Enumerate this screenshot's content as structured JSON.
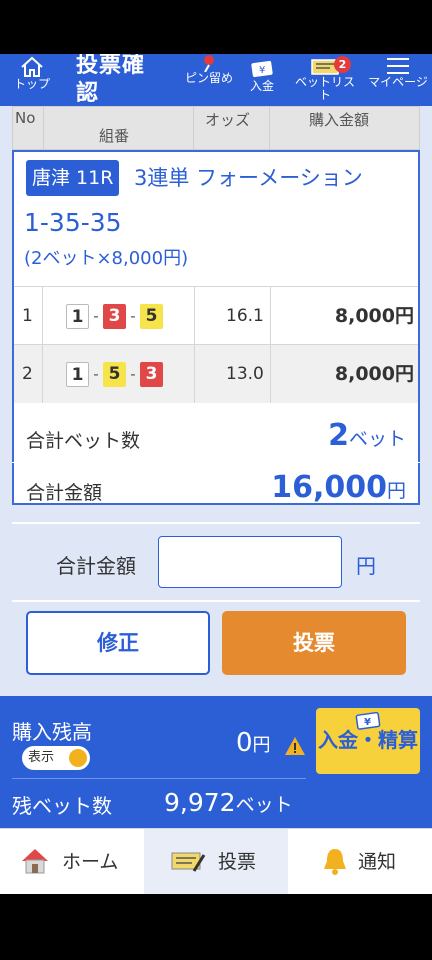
{
  "header": {
    "home_label": "トップ",
    "title": "投票確認",
    "pin_label": "ピン留め",
    "deposit_label": "入金",
    "bet_list_label": "ベットリスト",
    "bet_list_badge": "2",
    "mypage_label": "マイページ"
  },
  "table_header": {
    "no": "No",
    "combination": "組番",
    "odds": "オッズ",
    "amount": "購入金額"
  },
  "bet_card": {
    "venue_race": "唐津 11R",
    "bet_type": "3連単 フォーメーション",
    "combination": "1-35-35",
    "bet_note": "(2ベット×8,000円)",
    "rows": [
      {
        "no": "1",
        "n1": "1",
        "n2": "3",
        "n3": "5",
        "odds": "16.1",
        "amount": "8,000円"
      },
      {
        "no": "2",
        "n1": "1",
        "n2": "5",
        "n3": "3",
        "odds": "13.0",
        "amount": "8,000円"
      }
    ]
  },
  "summary": {
    "bets_label": "合計ベット数",
    "bets_value": "2",
    "bets_unit": "ベット",
    "total_label": "合計金額",
    "total_value": "16,000",
    "total_unit": "円"
  },
  "confirm": {
    "label": "合計金額",
    "input_value": "",
    "unit": "円"
  },
  "buttons": {
    "modify": "修正",
    "vote": "投票"
  },
  "balance": {
    "label": "購入残高",
    "toggle_label": "表示",
    "value": "0",
    "unit": "円",
    "deposit_button": "入金・精算",
    "remaining_label": "残ベット数",
    "remaining_value": "9,972",
    "remaining_unit": "ベット"
  },
  "tabs": {
    "home": "ホーム",
    "vote": "投票",
    "notify": "通知"
  },
  "colors": {
    "primary": "#2c5fd6",
    "vote_button": "#e58a2f",
    "badge": "#e23b3b"
  }
}
